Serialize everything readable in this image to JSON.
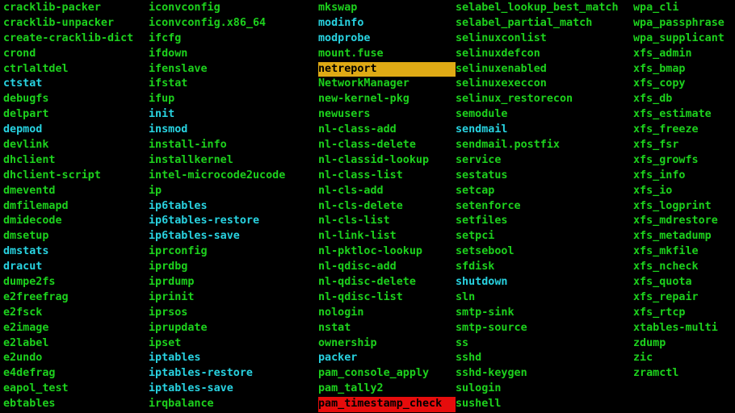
{
  "terminal": {
    "background": "#000000",
    "colors": {
      "executable": "#1dd11d",
      "symlink": "#28d2e0",
      "setuid_fg": "#000000",
      "setuid_bg": "#e60c0c",
      "other_writable_fg": "#000000",
      "other_writable_bg": "#dfaa15"
    },
    "columns": [
      {
        "name": "column-1",
        "entries": [
          {
            "text": "cracklib-packer",
            "type": "executable"
          },
          {
            "text": "cracklib-unpacker",
            "type": "executable"
          },
          {
            "text": "create-cracklib-dict",
            "type": "executable"
          },
          {
            "text": "crond",
            "type": "executable"
          },
          {
            "text": "ctrlaltdel",
            "type": "executable"
          },
          {
            "text": "ctstat",
            "type": "symlink"
          },
          {
            "text": "debugfs",
            "type": "executable"
          },
          {
            "text": "delpart",
            "type": "executable"
          },
          {
            "text": "depmod",
            "type": "symlink"
          },
          {
            "text": "devlink",
            "type": "executable"
          },
          {
            "text": "dhclient",
            "type": "executable"
          },
          {
            "text": "dhclient-script",
            "type": "executable"
          },
          {
            "text": "dmeventd",
            "type": "executable"
          },
          {
            "text": "dmfilemapd",
            "type": "executable"
          },
          {
            "text": "dmidecode",
            "type": "executable"
          },
          {
            "text": "dmsetup",
            "type": "executable"
          },
          {
            "text": "dmstats",
            "type": "symlink"
          },
          {
            "text": "dracut",
            "type": "symlink"
          },
          {
            "text": "dumpe2fs",
            "type": "executable"
          },
          {
            "text": "e2freefrag",
            "type": "executable"
          },
          {
            "text": "e2fsck",
            "type": "executable"
          },
          {
            "text": "e2image",
            "type": "executable"
          },
          {
            "text": "e2label",
            "type": "executable"
          },
          {
            "text": "e2undo",
            "type": "executable"
          },
          {
            "text": "e4defrag",
            "type": "executable"
          },
          {
            "text": "eapol_test",
            "type": "executable"
          },
          {
            "text": "ebtables",
            "type": "executable"
          }
        ]
      },
      {
        "name": "column-2",
        "entries": [
          {
            "text": "iconvconfig",
            "type": "executable"
          },
          {
            "text": "iconvconfig.x86_64",
            "type": "executable"
          },
          {
            "text": "ifcfg",
            "type": "executable"
          },
          {
            "text": "ifdown",
            "type": "executable"
          },
          {
            "text": "ifenslave",
            "type": "executable"
          },
          {
            "text": "ifstat",
            "type": "executable"
          },
          {
            "text": "ifup",
            "type": "executable"
          },
          {
            "text": "init",
            "type": "symlink"
          },
          {
            "text": "insmod",
            "type": "symlink"
          },
          {
            "text": "install-info",
            "type": "executable"
          },
          {
            "text": "installkernel",
            "type": "executable"
          },
          {
            "text": "intel-microcode2ucode",
            "type": "executable"
          },
          {
            "text": "ip",
            "type": "executable"
          },
          {
            "text": "ip6tables",
            "type": "symlink"
          },
          {
            "text": "ip6tables-restore",
            "type": "symlink"
          },
          {
            "text": "ip6tables-save",
            "type": "symlink"
          },
          {
            "text": "iprconfig",
            "type": "executable"
          },
          {
            "text": "iprdbg",
            "type": "executable"
          },
          {
            "text": "iprdump",
            "type": "executable"
          },
          {
            "text": "iprinit",
            "type": "executable"
          },
          {
            "text": "iprsos",
            "type": "executable"
          },
          {
            "text": "iprupdate",
            "type": "executable"
          },
          {
            "text": "ipset",
            "type": "executable"
          },
          {
            "text": "iptables",
            "type": "symlink"
          },
          {
            "text": "iptables-restore",
            "type": "symlink"
          },
          {
            "text": "iptables-save",
            "type": "symlink"
          },
          {
            "text": "irqbalance",
            "type": "executable"
          }
        ]
      },
      {
        "name": "column-3",
        "entries": [
          {
            "text": "mkswap",
            "type": "executable"
          },
          {
            "text": "modinfo",
            "type": "symlink"
          },
          {
            "text": "modprobe",
            "type": "symlink"
          },
          {
            "text": "mount.fuse",
            "type": "executable"
          },
          {
            "text": "netreport",
            "type": "other-writable"
          },
          {
            "text": "NetworkManager",
            "type": "executable"
          },
          {
            "text": "new-kernel-pkg",
            "type": "executable"
          },
          {
            "text": "newusers",
            "type": "executable"
          },
          {
            "text": "nl-class-add",
            "type": "executable"
          },
          {
            "text": "nl-class-delete",
            "type": "executable"
          },
          {
            "text": "nl-classid-lookup",
            "type": "executable"
          },
          {
            "text": "nl-class-list",
            "type": "executable"
          },
          {
            "text": "nl-cls-add",
            "type": "executable"
          },
          {
            "text": "nl-cls-delete",
            "type": "executable"
          },
          {
            "text": "nl-cls-list",
            "type": "executable"
          },
          {
            "text": "nl-link-list",
            "type": "executable"
          },
          {
            "text": "nl-pktloc-lookup",
            "type": "executable"
          },
          {
            "text": "nl-qdisc-add",
            "type": "executable"
          },
          {
            "text": "nl-qdisc-delete",
            "type": "executable"
          },
          {
            "text": "nl-qdisc-list",
            "type": "executable"
          },
          {
            "text": "nologin",
            "type": "executable"
          },
          {
            "text": "nstat",
            "type": "executable"
          },
          {
            "text": "ownership",
            "type": "executable"
          },
          {
            "text": "packer",
            "type": "symlink"
          },
          {
            "text": "pam_console_apply",
            "type": "executable"
          },
          {
            "text": "pam_tally2",
            "type": "executable"
          },
          {
            "text": "pam_timestamp_check",
            "type": "setuid"
          }
        ]
      },
      {
        "name": "column-4",
        "entries": [
          {
            "text": "selabel_lookup_best_match",
            "type": "executable"
          },
          {
            "text": "selabel_partial_match",
            "type": "executable"
          },
          {
            "text": "selinuxconlist",
            "type": "executable"
          },
          {
            "text": "selinuxdefcon",
            "type": "executable"
          },
          {
            "text": "selinuxenabled",
            "type": "executable"
          },
          {
            "text": "selinuxexeccon",
            "type": "executable"
          },
          {
            "text": "selinux_restorecon",
            "type": "executable"
          },
          {
            "text": "semodule",
            "type": "executable"
          },
          {
            "text": "sendmail",
            "type": "symlink"
          },
          {
            "text": "sendmail.postfix",
            "type": "executable"
          },
          {
            "text": "service",
            "type": "executable"
          },
          {
            "text": "sestatus",
            "type": "executable"
          },
          {
            "text": "setcap",
            "type": "executable"
          },
          {
            "text": "setenforce",
            "type": "executable"
          },
          {
            "text": "setfiles",
            "type": "executable"
          },
          {
            "text": "setpci",
            "type": "executable"
          },
          {
            "text": "setsebool",
            "type": "executable"
          },
          {
            "text": "sfdisk",
            "type": "executable"
          },
          {
            "text": "shutdown",
            "type": "symlink"
          },
          {
            "text": "sln",
            "type": "executable"
          },
          {
            "text": "smtp-sink",
            "type": "executable"
          },
          {
            "text": "smtp-source",
            "type": "executable"
          },
          {
            "text": "ss",
            "type": "executable"
          },
          {
            "text": "sshd",
            "type": "executable"
          },
          {
            "text": "sshd-keygen",
            "type": "executable"
          },
          {
            "text": "sulogin",
            "type": "executable"
          },
          {
            "text": "sushell",
            "type": "executable"
          }
        ]
      },
      {
        "name": "column-5",
        "entries": [
          {
            "text": "wpa_cli",
            "type": "executable"
          },
          {
            "text": "wpa_passphrase",
            "type": "executable"
          },
          {
            "text": "wpa_supplicant",
            "type": "executable"
          },
          {
            "text": "xfs_admin",
            "type": "executable"
          },
          {
            "text": "xfs_bmap",
            "type": "executable"
          },
          {
            "text": "xfs_copy",
            "type": "executable"
          },
          {
            "text": "xfs_db",
            "type": "executable"
          },
          {
            "text": "xfs_estimate",
            "type": "executable"
          },
          {
            "text": "xfs_freeze",
            "type": "executable"
          },
          {
            "text": "xfs_fsr",
            "type": "executable"
          },
          {
            "text": "xfs_growfs",
            "type": "executable"
          },
          {
            "text": "xfs_info",
            "type": "executable"
          },
          {
            "text": "xfs_io",
            "type": "executable"
          },
          {
            "text": "xfs_logprint",
            "type": "executable"
          },
          {
            "text": "xfs_mdrestore",
            "type": "executable"
          },
          {
            "text": "xfs_metadump",
            "type": "executable"
          },
          {
            "text": "xfs_mkfile",
            "type": "executable"
          },
          {
            "text": "xfs_ncheck",
            "type": "executable"
          },
          {
            "text": "xfs_quota",
            "type": "executable"
          },
          {
            "text": "xfs_repair",
            "type": "executable"
          },
          {
            "text": "xfs_rtcp",
            "type": "executable"
          },
          {
            "text": "xtables-multi",
            "type": "executable"
          },
          {
            "text": "zdump",
            "type": "executable"
          },
          {
            "text": "zic",
            "type": "executable"
          },
          {
            "text": "zramctl",
            "type": "executable"
          }
        ]
      }
    ]
  }
}
